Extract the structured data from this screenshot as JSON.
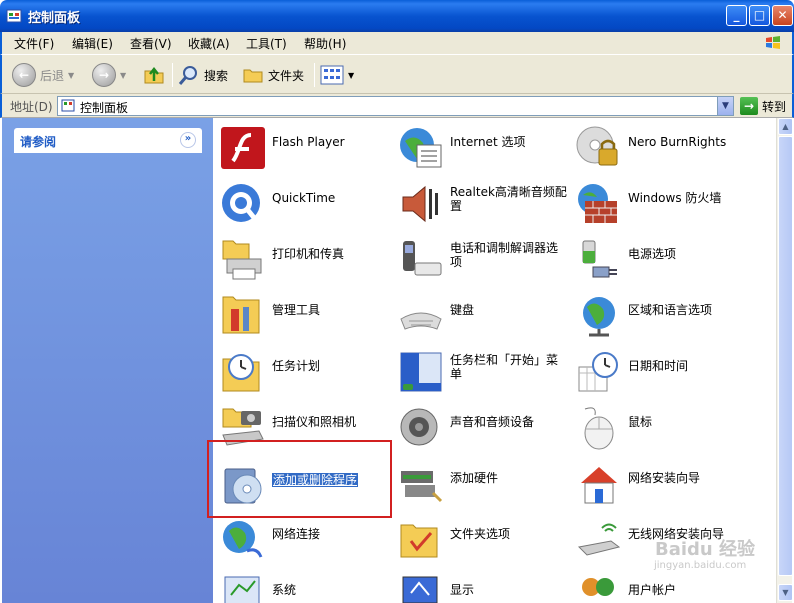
{
  "window": {
    "title": "控制面板"
  },
  "menu": [
    "文件(F)",
    "编辑(E)",
    "查看(V)",
    "收藏(A)",
    "工具(T)",
    "帮助(H)"
  ],
  "toolbar": {
    "back_label": "后退",
    "search_label": "搜索",
    "folders_label": "文件夹"
  },
  "address": {
    "label": "地址(D)",
    "value": "控制面板",
    "go_label": "转到"
  },
  "taskpane": {
    "see_also": "请参阅"
  },
  "items": [
    {
      "label": "Flash Player",
      "icon": "flash-player-icon"
    },
    {
      "label": "Internet 选项",
      "icon": "internet-options-icon"
    },
    {
      "label": "Nero BurnRights",
      "icon": "nero-burnrights-icon"
    },
    {
      "label": "QuickTime",
      "icon": "quicktime-icon"
    },
    {
      "label": "Realtek高清晰音频配置",
      "icon": "realtek-audio-icon"
    },
    {
      "label": "Windows 防火墙",
      "icon": "firewall-icon"
    },
    {
      "label": "打印机和传真",
      "icon": "printer-icon"
    },
    {
      "label": "电话和调制解调器选项",
      "icon": "phone-modem-icon"
    },
    {
      "label": "电源选项",
      "icon": "power-icon"
    },
    {
      "label": "管理工具",
      "icon": "admin-tools-icon"
    },
    {
      "label": "键盘",
      "icon": "keyboard-icon"
    },
    {
      "label": "区域和语言选项",
      "icon": "globe-icon"
    },
    {
      "label": "任务计划",
      "icon": "scheduled-tasks-icon"
    },
    {
      "label": "任务栏和「开始」菜单",
      "icon": "taskbar-icon"
    },
    {
      "label": "日期和时间",
      "icon": "datetime-icon"
    },
    {
      "label": "扫描仪和照相机",
      "icon": "scanner-camera-icon"
    },
    {
      "label": "声音和音频设备",
      "icon": "speaker-icon"
    },
    {
      "label": "鼠标",
      "icon": "mouse-icon"
    },
    {
      "label": "添加或删除程序",
      "icon": "add-remove-programs-icon"
    },
    {
      "label": "添加硬件",
      "icon": "add-hardware-icon"
    },
    {
      "label": "网络安装向导",
      "icon": "network-setup-icon"
    },
    {
      "label": "网络连接",
      "icon": "network-connections-icon"
    },
    {
      "label": "文件夹选项",
      "icon": "folder-options-icon"
    },
    {
      "label": "无线网络安装向导",
      "icon": "wireless-setup-icon"
    },
    {
      "label": "系统",
      "icon": "system-icon"
    },
    {
      "label": "显示",
      "icon": "display-icon"
    },
    {
      "label": "用户帐户",
      "icon": "user-accounts-icon"
    }
  ],
  "watermark": {
    "brand": "Baidu 经验",
    "url": "jingyan.baidu.com"
  }
}
